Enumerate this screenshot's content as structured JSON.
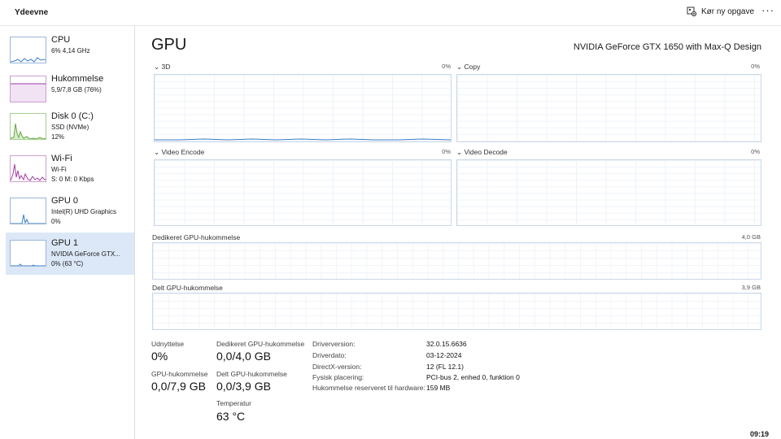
{
  "app": {
    "title": "Ydeevne"
  },
  "toolbar": {
    "run_task_label": "Kør ny opgave",
    "more_label": "···"
  },
  "sidebar": {
    "items": [
      {
        "title": "CPU",
        "line2": "6%  4,14 GHz",
        "line3": "",
        "color": "#3a7ec6"
      },
      {
        "title": "Hukommelse",
        "line2": "5,9/7,8 GB (76%)",
        "line3": "",
        "color": "#9b3aa8"
      },
      {
        "title": "Disk 0 (C:)",
        "line2": "SSD (NVMe)",
        "line3": "12%",
        "color": "#5fa83a"
      },
      {
        "title": "Wi-Fi",
        "line2": "Wi-Fi",
        "line3": "S: 0  M: 0 Kbps",
        "color": "#a33aa0"
      },
      {
        "title": "GPU 0",
        "line2": "Intel(R) UHD Graphics",
        "line3": "0%",
        "color": "#3a7ec6"
      },
      {
        "title": "GPU 1",
        "line2": "NVIDIA GeForce GTX...",
        "line3": "0%  (63 °C)",
        "color": "#3a7ec6"
      }
    ]
  },
  "main": {
    "title": "GPU",
    "subtitle": "NVIDIA GeForce GTX 1650 with Max-Q Design",
    "graphs": [
      {
        "label": "3D",
        "percent": "0%"
      },
      {
        "label": "Copy",
        "percent": "0%"
      },
      {
        "label": "Video Encode",
        "percent": "0%"
      },
      {
        "label": "Video Decode",
        "percent": "0%"
      }
    ],
    "dedicated_memory": {
      "label": "Dedikeret GPU-hukommelse",
      "max": "4,0 GB"
    },
    "shared_memory": {
      "label": "Delt GPU-hukommelse",
      "max": "3,9 GB"
    }
  },
  "stats": {
    "utilization": {
      "label": "Udnyttelse",
      "value": "0%"
    },
    "dedicated": {
      "label": "Dedikeret GPU-hukommelse",
      "value": "0,0/4,0 GB"
    },
    "gpu_memory": {
      "label": "GPU-hukommelse",
      "value": "0,0/7,9 GB"
    },
    "shared": {
      "label": "Delt GPU-hukommelse",
      "value": "0,0/3,9 GB"
    },
    "temperature": {
      "label": "Temperatur",
      "value": "63 °C"
    }
  },
  "info": [
    {
      "key": "Driverversion:",
      "value": "32.0.15.6636"
    },
    {
      "key": "Driverdato:",
      "value": "03-12-2024"
    },
    {
      "key": "DirectX-version:",
      "value": "12 (FL 12.1)"
    },
    {
      "key": "Fysisk placering:",
      "value": "PCI-bus 2, enhed 0, funktion 0"
    },
    {
      "key": "Hukommelse reserveret til hardware:",
      "value": "159 MB"
    }
  ],
  "clock": "09:19",
  "colors": {
    "accent": "#3a7ec6",
    "selected_bg": "#dce8f7",
    "graph_border": "#c9d8ea"
  }
}
